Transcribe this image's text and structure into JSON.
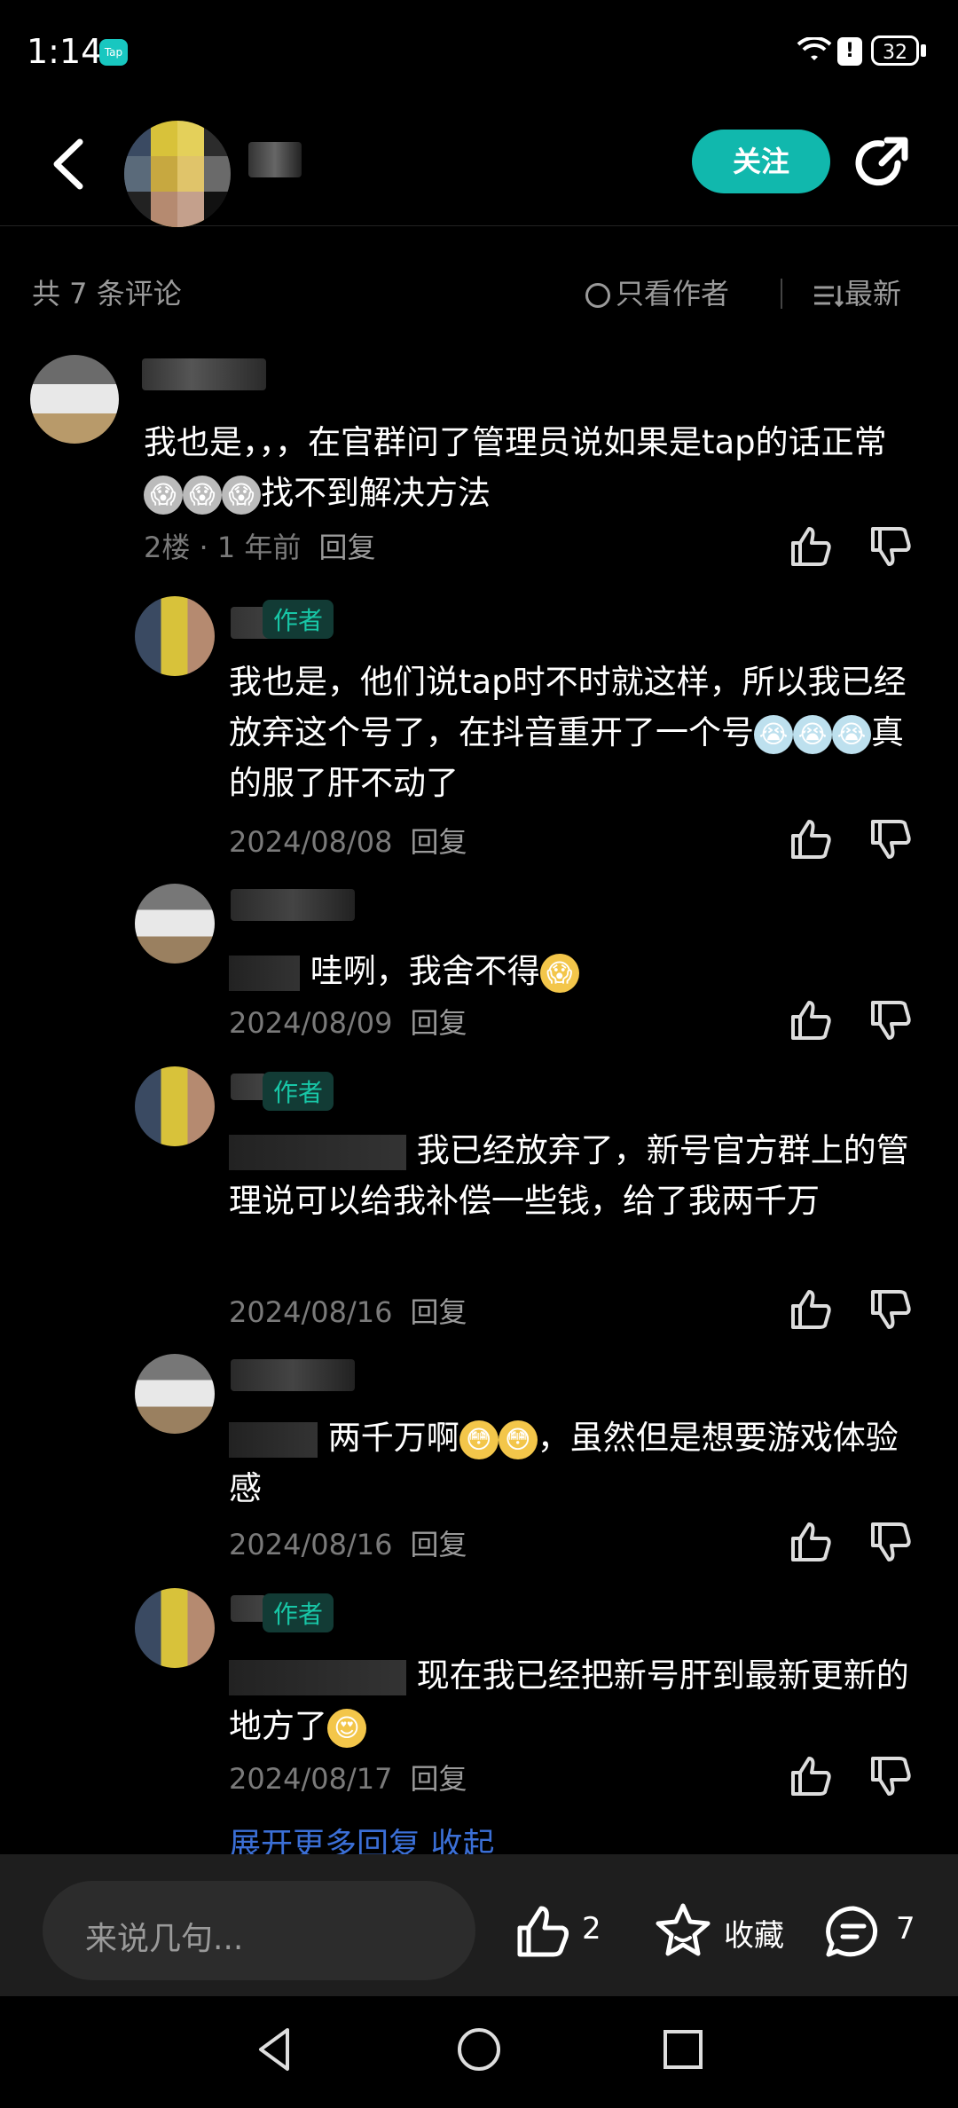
{
  "status": {
    "time": "1:14",
    "app_badge": "Tap",
    "battery": "32"
  },
  "header": {
    "follow_label": "关注"
  },
  "meta": {
    "total_label": "共 7 条评论",
    "only_author_label": "只看作者",
    "sort_label": "最新"
  },
  "comments": [
    {
      "text": "我也是，，，在官群问了管理员说如果是tap的话正常",
      "text_after": "找不到解决方法",
      "floor": "2楼",
      "time": "1 年前",
      "reply": "回复"
    },
    {
      "badge": "作者",
      "text": "我也是，他们说tap时不时就这样，所以我已经放弃这个号了，在抖音重开了一个号",
      "text_after": "真的服了肝不动了",
      "date": "2024/08/08",
      "reply": "回复"
    },
    {
      "text": "哇咧，我舍不得",
      "date": "2024/08/09",
      "reply": "回复"
    },
    {
      "badge": "作者",
      "text": "我已经放弃了，新号官方群上的管理说可以给我补偿一些钱，给了我两千万",
      "date": "2024/08/16",
      "reply": "回复"
    },
    {
      "text": "两千万啊",
      "text_after": "，虽然但是想要游戏体验感",
      "date": "2024/08/16",
      "reply": "回复"
    },
    {
      "badge": "作者",
      "text": "现在我已经把新号肝到最新更新的地方了",
      "date": "2024/08/17",
      "reply": "回复"
    }
  ],
  "expand_more": "展开更多回复  收起",
  "bottom": {
    "input_placeholder": "来说几句...",
    "like_count": "2",
    "fav_label": "收藏",
    "comment_count": "7"
  },
  "colors": {
    "accent": "#11b8ad",
    "author_badge": "#18c7a7",
    "link": "#3b6fd6"
  }
}
